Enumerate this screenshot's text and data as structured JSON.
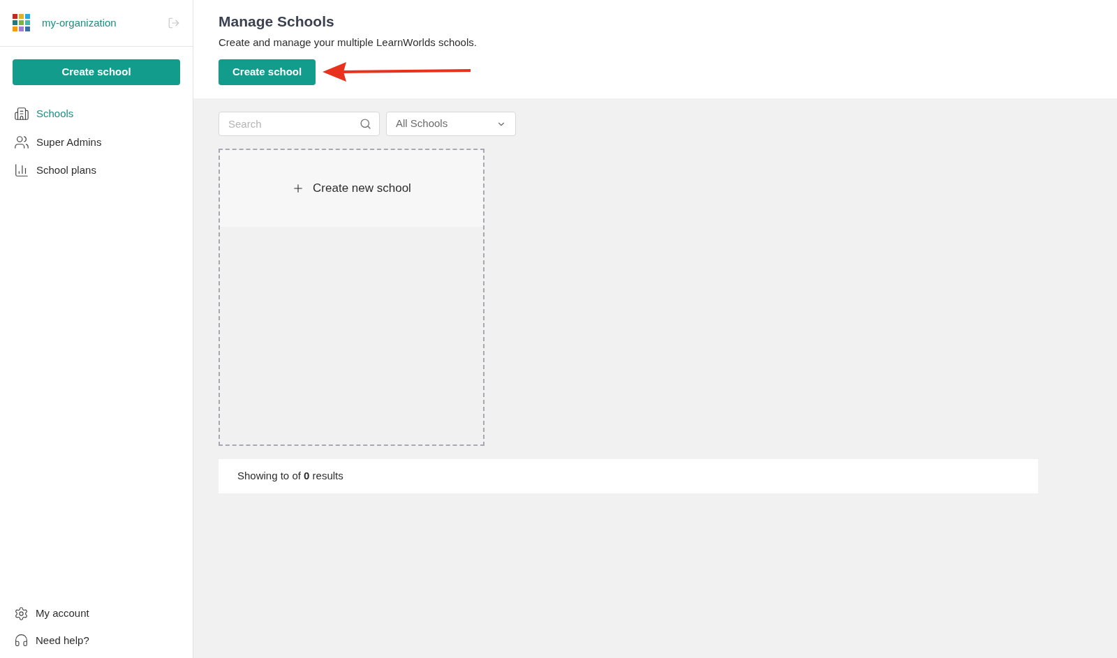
{
  "sidebar": {
    "org_name": "my-organization",
    "create_button": "Create school",
    "items": [
      {
        "label": "Schools",
        "selected": true
      },
      {
        "label": "Super Admins",
        "selected": false
      },
      {
        "label": "School plans",
        "selected": false
      }
    ],
    "footer_items": [
      {
        "label": "My account"
      },
      {
        "label": "Need help?"
      }
    ]
  },
  "header": {
    "title": "Manage Schools",
    "subtitle": "Create and manage your multiple LearnWorlds schools.",
    "create_button": "Create school"
  },
  "filters": {
    "search_placeholder": "Search",
    "dropdown_value": "All Schools"
  },
  "new_school_card": {
    "label": "Create new school"
  },
  "results": "Showing to of **0** results"
}
